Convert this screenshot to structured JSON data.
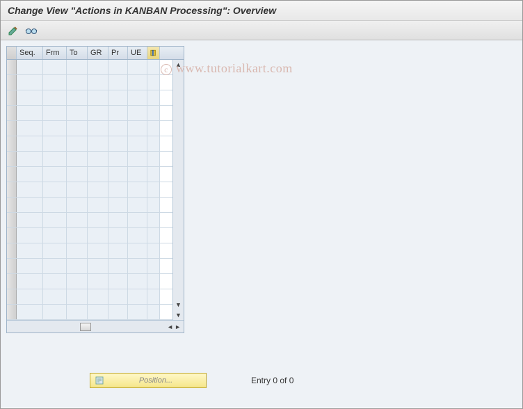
{
  "title": "Change View \"Actions in KANBAN Processing\": Overview",
  "watermark": "www.tutorialkart.com",
  "toolbar": {
    "icon1": "edit-icon",
    "icon2": "glasses-icon"
  },
  "grid": {
    "columns": [
      "Seq.",
      "Frm",
      "To",
      "GR",
      "Pr",
      "UE"
    ],
    "row_count": 17,
    "tool_icon": "columns-icon"
  },
  "hscroll": {
    "left": "◄",
    "right": "►"
  },
  "vscroll": {
    "up": "▲",
    "down": "▼"
  },
  "position_button": {
    "label": "Position...",
    "icon": "position-icon"
  },
  "entry_status": "Entry 0 of 0"
}
